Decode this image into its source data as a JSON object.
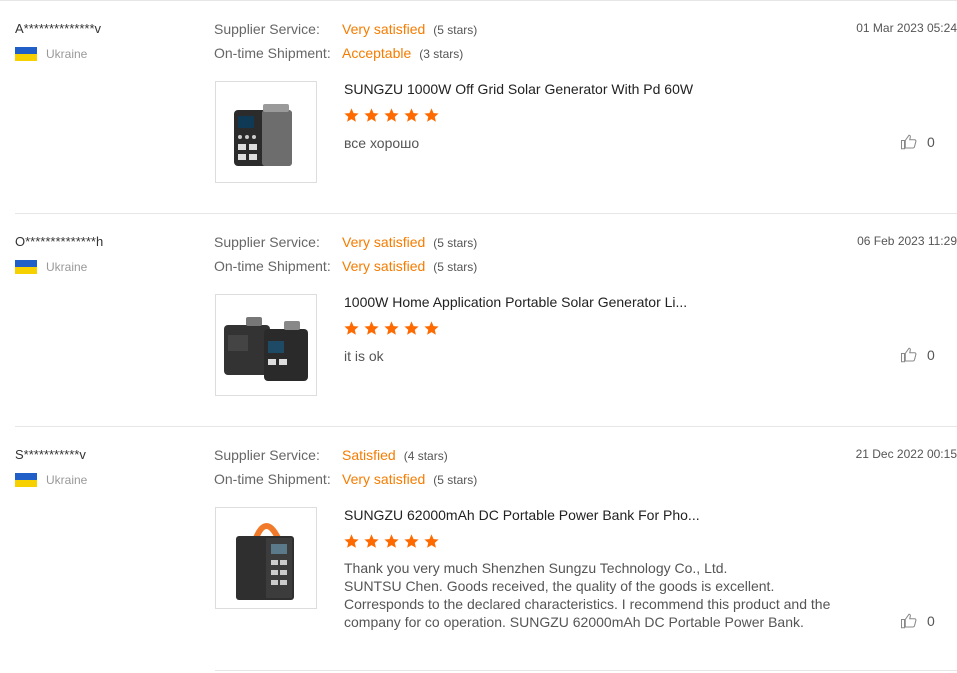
{
  "reviews": [
    {
      "user": "A**************v",
      "country": "Ukraine",
      "supplier_label": "Supplier Service:",
      "supplier_value": "Very satisfied",
      "supplier_stars": "(5 stars)",
      "shipment_label": "On-time Shipment:",
      "shipment_value": "Acceptable",
      "shipment_stars": "(3 stars)",
      "date": "01 Mar 2023 05:24",
      "product": "SUNGZU 1000W Off Grid Solar Generator With Pd 60W",
      "rating": 5,
      "comment": "все хорошо",
      "likes": "0"
    },
    {
      "user": "O**************h",
      "country": "Ukraine",
      "supplier_label": "Supplier Service:",
      "supplier_value": "Very satisfied",
      "supplier_stars": "(5 stars)",
      "shipment_label": "On-time Shipment:",
      "shipment_value": "Very satisfied",
      "shipment_stars": "(5 stars)",
      "date": "06 Feb 2023 11:29",
      "product": "1000W Home Application Portable Solar Generator Li...",
      "rating": 5,
      "comment": "it is ok",
      "likes": "0"
    },
    {
      "user": "S***********v",
      "country": "Ukraine",
      "supplier_label": "Supplier Service:",
      "supplier_value": "Satisfied",
      "supplier_stars": "(4 stars)",
      "shipment_label": "On-time Shipment:",
      "shipment_value": "Very satisfied",
      "shipment_stars": "(5 stars)",
      "date": "21 Dec 2022 00:15",
      "product": "SUNGZU 62000mAh DC Portable Power Bank For Pho...",
      "rating": 5,
      "comment": "Thank you very much Shenzhen Sungzu Technology Co., Ltd.\nSUNTSU Chen. Goods received, the quality of the goods is excellent. Corresponds to the declared characteristics. I recommend this product and the company for co operation. SUNGZU 62000mAh DC Portable Power Bank.",
      "likes": "0"
    }
  ],
  "colors": {
    "accent": "#f57c00",
    "star": "#ff6a00"
  },
  "icons": {
    "like": "thumbs-up-icon",
    "flag": "ukraine-flag-icon",
    "star": "star-icon"
  }
}
